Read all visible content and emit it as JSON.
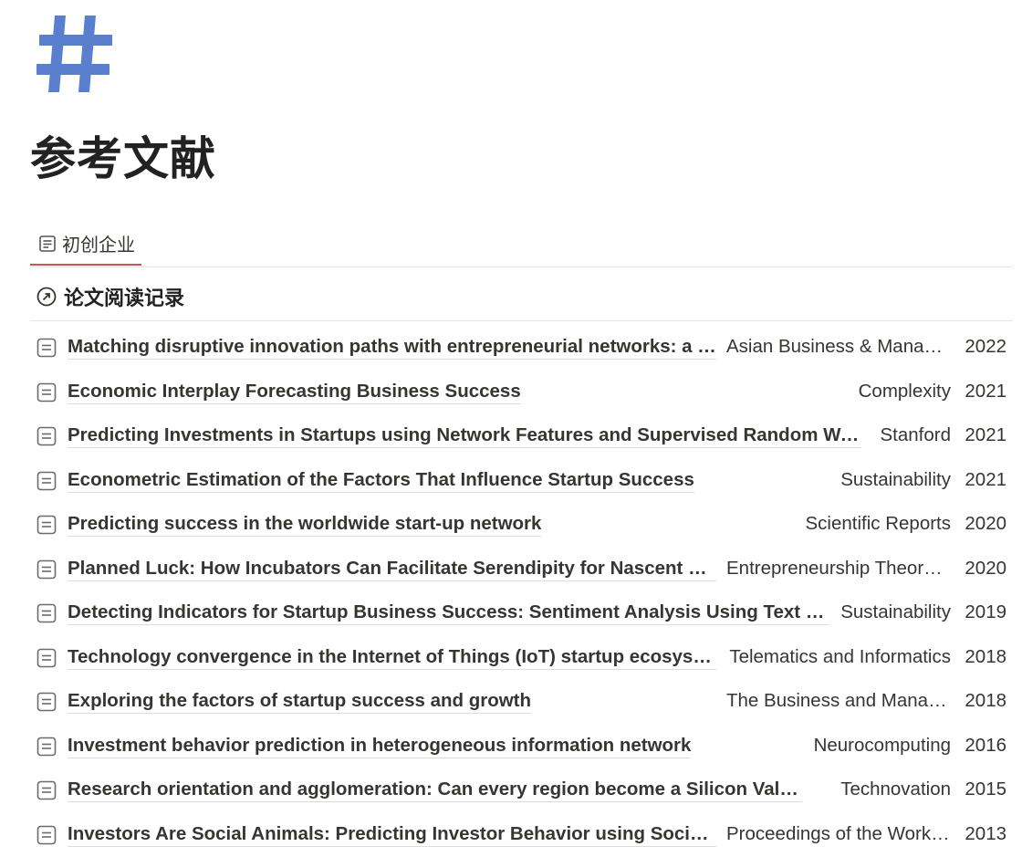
{
  "page": {
    "icon": "hash-icon",
    "title": "参考文献",
    "accent_color": "#5a7fcf"
  },
  "tabs": [
    {
      "label": "初创企业",
      "icon": "page-icon",
      "active": true
    }
  ],
  "view": {
    "title": "论文阅读记录",
    "icon": "arrow-up-right-circle-icon"
  },
  "rows": [
    {
      "title": "Matching disruptive innovation paths with entrepreneurial networks: a n…",
      "journal": "Asian Business & Manage…",
      "year": "2022"
    },
    {
      "title": "Economic Interplay Forecasting Business Success",
      "journal": "Complexity",
      "year": "2021"
    },
    {
      "title": "Predicting Investments in Startups using Network Features and Supervised Random Walks",
      "journal": "Stanford",
      "year": "2021"
    },
    {
      "title": "Econometric Estimation of the Factors That Influence Startup Success",
      "journal": "Sustainability",
      "year": "2021"
    },
    {
      "title": "Predicting success in the worldwide start-up network",
      "journal": "Scientific Reports",
      "year": "2020"
    },
    {
      "title": "Planned Luck: How Incubators Can Facilitate Serendipity for Nascent En…",
      "journal": "Entrepreneurship Theory …",
      "year": "2020"
    },
    {
      "title": "Detecting Indicators for Startup Business Success: Sentiment Analysis Using Text Da…",
      "journal": "Sustainability",
      "year": "2019"
    },
    {
      "title": "Technology convergence in the Internet of Things (IoT) startup ecosyste…",
      "journal": "Telematics and Informatics",
      "year": "2018"
    },
    {
      "title": "Exploring the factors of startup success and growth",
      "journal": "The Business and Manag…",
      "year": "2018"
    },
    {
      "title": "Investment behavior prediction in heterogeneous information network",
      "journal": "Neurocomputing",
      "year": "2016"
    },
    {
      "title": "Research orientation and agglomeration: Can every region become a Silicon Valley?",
      "journal": "Technovation",
      "year": "2015"
    },
    {
      "title": "Investors Are Social Animals: Predicting Investor Behavior using Social …",
      "journal": "Proceedings of the Works…",
      "year": "2013"
    }
  ]
}
